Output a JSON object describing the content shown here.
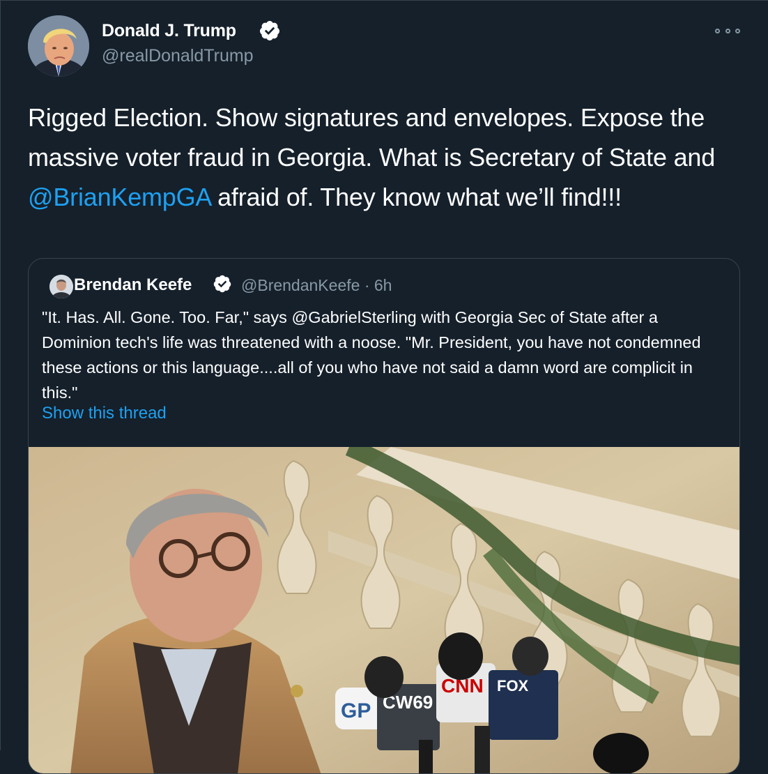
{
  "tweet": {
    "author_name": "Donald J. Trump",
    "author_handle": "@realDonaldTrump",
    "text_before": "Rigged Election. Show signatures and envelopes. Expose the massive voter fraud in Georgia. What is Secretary of State and ",
    "mention": "@BrianKempGA",
    "text_after": " afraid of. They know what we’ll find!!!",
    "verified_icon": "verified-badge-icon",
    "more_icon": "more-options-icon"
  },
  "quote": {
    "author_name": "Brendan Keefe",
    "author_handle": "@BrendanKeefe",
    "separator": "·",
    "timestamp": "6h",
    "text": "\"It. Has. All. Gone. Too. Far,\" says @GabrielSterling with Georgia Sec of State after a Dominion tech's life was threatened with a noose. \"Mr. President, you have not condemned these actions or this language....all of you who have not said a damn word are complicit in this.\"",
    "thread_link": "Show this thread",
    "media_mic_labels": [
      "GP",
      "CW69",
      "CNN",
      "FOX"
    ]
  },
  "colors": {
    "background": "#15202b",
    "text": "#ffffff",
    "secondary": "#8899a6",
    "accent": "#1da1f2",
    "border": "#38444d"
  }
}
